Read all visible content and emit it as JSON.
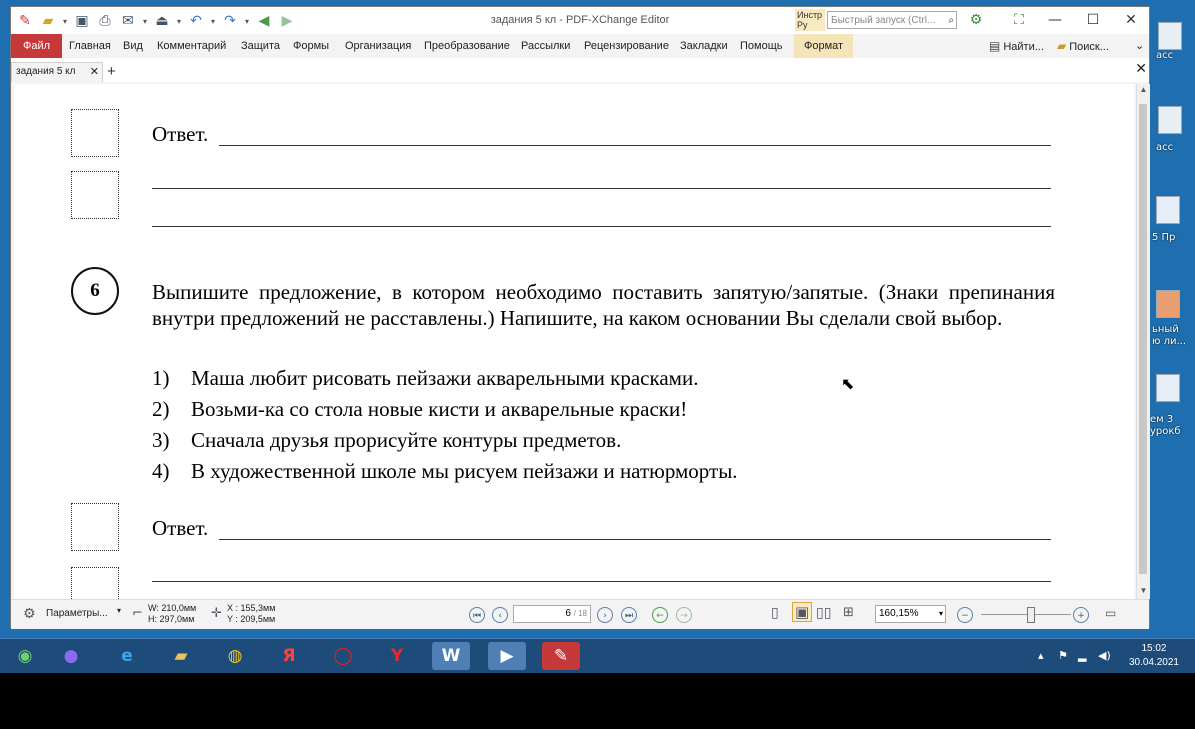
{
  "window": {
    "title": "задания 5 кл - PDF-XChange Editor",
    "instr_label": "Инстр\nРу",
    "search_placeholder": "Быстрый запуск (Ctrl...",
    "min_label": "—",
    "max_label": "☐",
    "close_label": "✕"
  },
  "ribbon": {
    "tabs": [
      "Файл",
      "Главная",
      "Вид",
      "Комментарий",
      "Защита",
      "Формы",
      "Организация",
      "Преобразование",
      "Рассылки",
      "Рецензирование",
      "Закладки",
      "Помощь",
      "Формат"
    ],
    "find_label": "Найти...",
    "search_label": "Поиск...",
    "collapse_icon": "⌄"
  },
  "doc_tabs": {
    "tab_label": "задания 5 кл",
    "tab_close": "✕",
    "new_tab": "+",
    "close_all": "✕"
  },
  "document": {
    "answer_label": "Ответ.",
    "q_number": "6",
    "question": "Выпишите предложение, в котором необходимо поставить запятую/запятые. (Знаки препинания внутри предложений не расставлены.) Напишите, на каком основании Вы сделали свой выбор.",
    "options": [
      {
        "n": "1)",
        "text": "Маша любит рисовать пейзажи акварельными красками."
      },
      {
        "n": "2)",
        "text": "Возьми-ка со стола новые кисти и акварельные краски!"
      },
      {
        "n": "3)",
        "text": "Сначала друзья прорисуйте контуры предметов."
      },
      {
        "n": "4)",
        "text": "В художественной школе мы рисуем пейзажи и натюрморты."
      }
    ]
  },
  "statusbar": {
    "params_label": "Параметры...",
    "page_w": "W: 210,0мм",
    "page_h": "H: 297,0мм",
    "cursor_x": "X : 155,3мм",
    "cursor_y": "Y : 209,5мм",
    "page_current": "6",
    "page_total": "/ 18",
    "zoom": "160,15%"
  },
  "desktop_labels": [
    "асс",
    "асс",
    "5 Пр",
    "ьный\nю ли...",
    "ем 3\nурокб"
  ],
  "taskbar": {
    "time": "15:02",
    "date": "30.04.2021"
  },
  "colors": {
    "file_tab": "#c6393b",
    "format_tab": "#f4e4b8",
    "taskbar": "#1d4c7a",
    "desktop": "#1f6fb0"
  }
}
